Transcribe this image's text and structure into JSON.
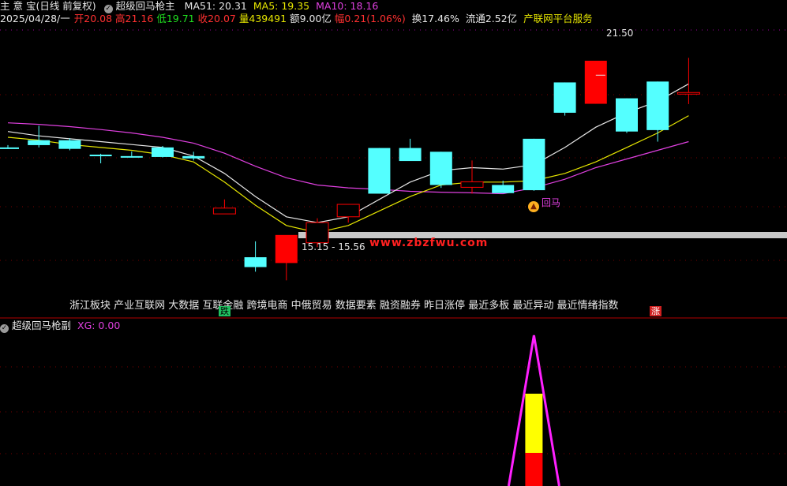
{
  "header": {
    "row1": {
      "title": "主 意 宝(日线 前复权)",
      "indicator_name": "超级回马枪主",
      "ma51": "MA51: 20.31",
      "ma5": "MA5: 19.35",
      "ma10": "MA10: 18.16"
    },
    "row2": {
      "date": "2025/04/28/一",
      "open": "开20.08",
      "high": "高21.16",
      "low": "低19.71",
      "close": "收20.07",
      "volume": "量439491",
      "amount": "额9.00亿",
      "change": "幅0.21(1.06%)",
      "turnover": "换17.46%",
      "float": "流通2.52亿",
      "service": "产联网平台服务"
    }
  },
  "sub_header": {
    "name": "超级回马枪副",
    "xg": "XG: 0.00"
  },
  "colors": {
    "up": "#ff0000",
    "down": "#54ffff",
    "ma51": "#e040e0",
    "ma5": "#e6e6e6",
    "ma10": "#e6e600",
    "signal_label": "#e040e0",
    "concept_text": "#e6e6e6",
    "watermark": "#ff2020",
    "xg_line": "#ff20ff",
    "xg_bar_top": "#ffff00",
    "xg_bar_bottom": "#ff0000"
  },
  "chart_data": [
    {
      "type": "candlestick",
      "ylim": [
        14.0,
        22.6
      ],
      "candles": [
        {
          "o": 19.0,
          "h": 19.08,
          "l": 18.95,
          "c": 18.96
        },
        {
          "o": 19.25,
          "h": 19.75,
          "l": 19.0,
          "c": 19.08
        },
        {
          "o": 19.25,
          "h": 19.32,
          "l": 18.9,
          "c": 18.95
        },
        {
          "o": 18.75,
          "h": 18.78,
          "l": 18.45,
          "c": 18.73
        },
        {
          "o": 18.7,
          "h": 18.86,
          "l": 18.65,
          "c": 18.66
        },
        {
          "o": 19.0,
          "h": 19.05,
          "l": 18.65,
          "c": 18.67
        },
        {
          "o": 18.7,
          "h": 18.85,
          "l": 18.55,
          "c": 18.62
        },
        {
          "o": 16.7,
          "h": 17.2,
          "l": 16.7,
          "c": 16.9
        },
        {
          "o": 15.2,
          "h": 15.75,
          "l": 14.7,
          "c": 14.86
        },
        {
          "o": 15.0,
          "h": 15.4,
          "l": 14.4,
          "c": 15.97
        },
        {
          "o": 15.7,
          "h": 16.55,
          "l": 15.55,
          "c": 16.4
        },
        {
          "o": 16.6,
          "h": 17.0,
          "l": 16.4,
          "c": 17.03
        },
        {
          "o": 18.98,
          "h": 18.98,
          "l": 17.4,
          "c": 17.4
        },
        {
          "o": 18.98,
          "h": 19.3,
          "l": 18.55,
          "c": 18.53
        },
        {
          "o": 18.85,
          "h": 18.85,
          "l": 17.6,
          "c": 17.7
        },
        {
          "o": 17.62,
          "h": 18.55,
          "l": 17.4,
          "c": 17.81
        },
        {
          "o": 17.7,
          "h": 17.85,
          "l": 17.45,
          "c": 17.42
        },
        {
          "o": 19.3,
          "h": 19.3,
          "l": 17.5,
          "c": 17.52
        },
        {
          "o": 21.25,
          "h": 21.25,
          "l": 20.1,
          "c": 20.2
        },
        {
          "o": 20.51,
          "h": 21.5,
          "l": 20.51,
          "c": 22.0
        },
        {
          "o": 20.7,
          "h": 20.7,
          "l": 19.5,
          "c": 19.55
        },
        {
          "o": 21.28,
          "h": 21.28,
          "l": 19.2,
          "c": 19.6
        },
        {
          "o": 20.9,
          "h": 22.1,
          "l": 20.5,
          "c": 20.9
        }
      ],
      "ma51": [
        19.85,
        19.8,
        19.72,
        19.62,
        19.5,
        19.35,
        19.15,
        18.8,
        18.35,
        17.95,
        17.7,
        17.6,
        17.55,
        17.48,
        17.45,
        17.43,
        17.4,
        17.6,
        17.9,
        18.3,
        18.6,
        18.9,
        19.2
      ],
      "ma5": [
        19.55,
        19.4,
        19.3,
        19.2,
        19.1,
        19.0,
        18.7,
        18.1,
        17.3,
        16.6,
        16.4,
        16.6,
        17.2,
        17.8,
        18.2,
        18.3,
        18.25,
        18.4,
        19.0,
        19.7,
        20.2,
        20.6,
        21.2
      ],
      "ma10": [
        19.35,
        19.25,
        19.1,
        19.0,
        18.9,
        18.75,
        18.5,
        17.8,
        17.0,
        16.3,
        16.05,
        16.3,
        16.8,
        17.3,
        17.7,
        17.8,
        17.8,
        17.85,
        18.1,
        18.5,
        19.0,
        19.5,
        20.1
      ],
      "annotations": {
        "high_label": "21.50",
        "low_label": "15.15 - 15.56",
        "signal_label": "回马"
      }
    },
    {
      "type": "line",
      "name": "XG",
      "values": [
        0,
        0,
        0,
        0,
        0,
        0,
        0,
        0,
        0,
        0,
        0,
        0,
        0,
        0,
        0,
        0,
        0,
        1,
        0,
        0,
        0,
        0,
        0
      ]
    }
  ],
  "concepts": "浙江板块 产业互联网 大数据 互联金融 跨境电商 中俄贸易 数据要素 融资融券 昨日涨停 最近多板 最近异动 最近情绪指数",
  "markers": {
    "die": "跌",
    "zhang": "涨"
  },
  "watermark": "www.zbzfwu.com"
}
